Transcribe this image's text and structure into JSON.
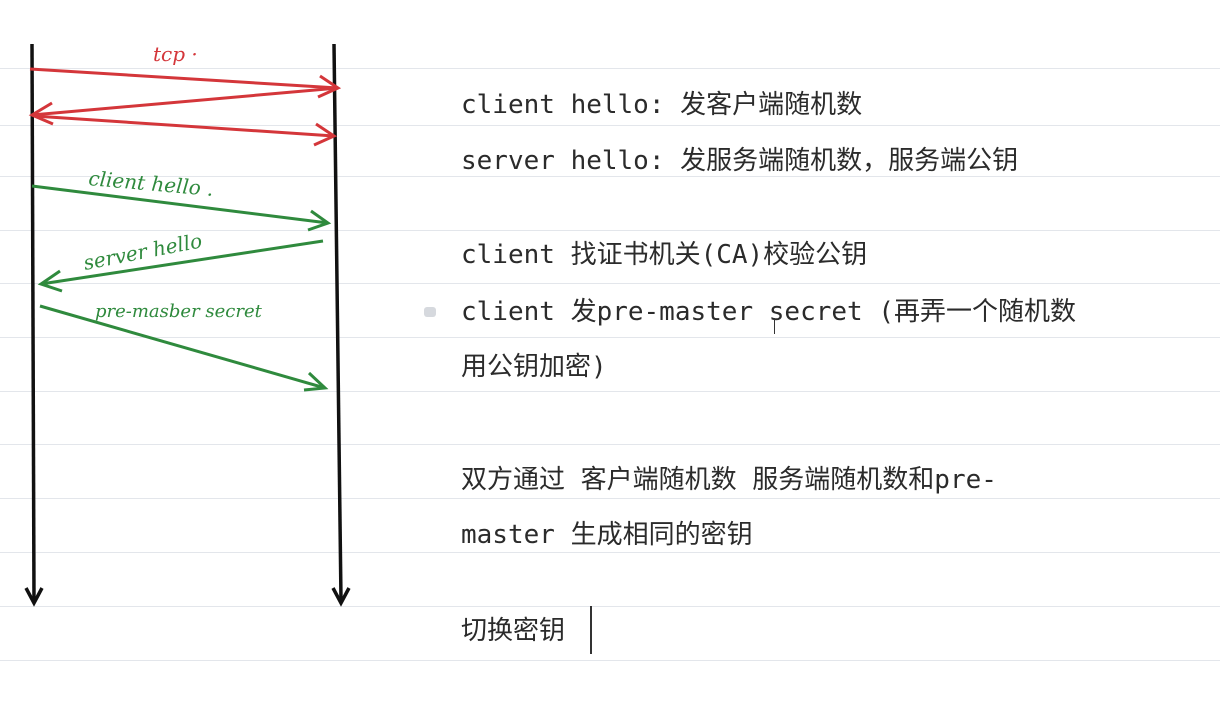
{
  "diagram": {
    "arrows": [
      {
        "label": "tcp ·",
        "color": "#d4363a"
      },
      {
        "label": "",
        "color": "#d4363a"
      },
      {
        "label": "",
        "color": "#d4363a"
      },
      {
        "label": "client  hello .",
        "color": "#2f8a3d"
      },
      {
        "label": "server  hello",
        "color": "#2f8a3d"
      },
      {
        "label": "pre-masber  secret",
        "color": "#2f8a3d"
      }
    ],
    "colors": {
      "lifeline": "#111111",
      "tcp": "#d4363a",
      "tls": "#2f8a3d"
    }
  },
  "notes": {
    "line1": "client hello: 发客户端随机数",
    "line2": "server hello: 发服务端随机数，服务端公钥",
    "line3": "client 找证书机关(CA)校验公钥",
    "line4": "client 发pre-master secret (再弄一个随机数",
    "line5": "用公钥加密)",
    "line6": "双方通过 客户端随机数 服务端随机数和pre-",
    "line7": "master 生成相同的密钥",
    "line8": "切换密钥"
  }
}
